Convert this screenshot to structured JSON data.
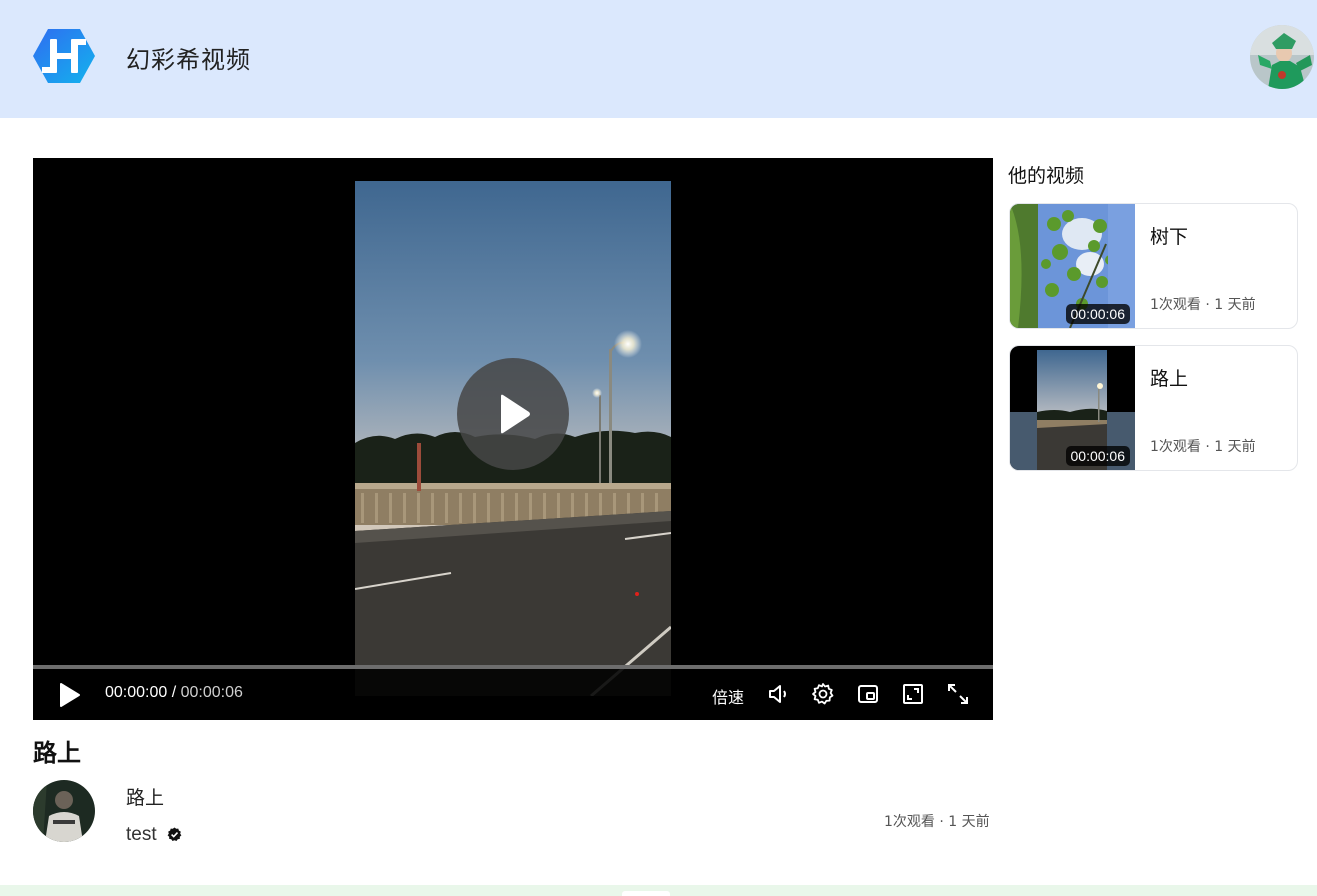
{
  "header": {
    "site_title": "幻彩希视频",
    "logo_letter": "H",
    "logo_color": "#1e7cf0"
  },
  "player": {
    "current_time": "00:00:00",
    "separator": " / ",
    "total_time": "00:00:06",
    "speed_label": "倍速",
    "progress": 0
  },
  "video": {
    "title": "路上",
    "description": "路上",
    "uploader": "test",
    "meta": "1次观看 · 1 天前"
  },
  "sidebar": {
    "heading": "他的视频",
    "items": [
      {
        "title": "树下",
        "duration": "00:00:06",
        "meta": "1次观看 · 1 天前"
      },
      {
        "title": "路上",
        "duration": "00:00:06",
        "meta": "1次观看 · 1 天前"
      }
    ]
  },
  "colors": {
    "header_bg": "#dbe8fd",
    "footer_bg": "#e9f7ea"
  }
}
